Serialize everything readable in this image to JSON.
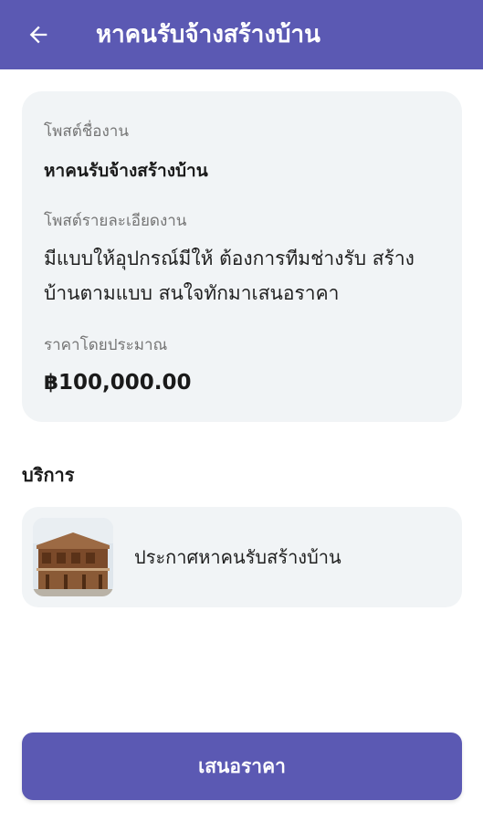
{
  "appbar": {
    "title": "หาคนรับจ้างสร้างบ้าน",
    "back_icon": "arrow-left-icon",
    "background": "#5b59b3"
  },
  "post": {
    "name_label": "โพสต์ชื่องาน",
    "name_value": "หาคนรับจ้างสร้างบ้าน",
    "detail_label": "โพสต์รายละเอียดงาน",
    "detail_value": "มีแบบให้อุปกรณ์มีให้ ต้องการทีมช่างรับ สร้างบ้านตามแบบ สนใจทักมาเสนอราคา",
    "price_label": "ราคาโดยประมาณ",
    "price_value": "฿100,000.00"
  },
  "services": {
    "heading": "บริการ",
    "items": [
      {
        "label": "ประกาศหาคนรับสร้างบ้าน",
        "thumbnail": "house-photo"
      }
    ]
  },
  "actions": {
    "submit_label": "เสนอราคา",
    "accent": "#5b59b3"
  }
}
